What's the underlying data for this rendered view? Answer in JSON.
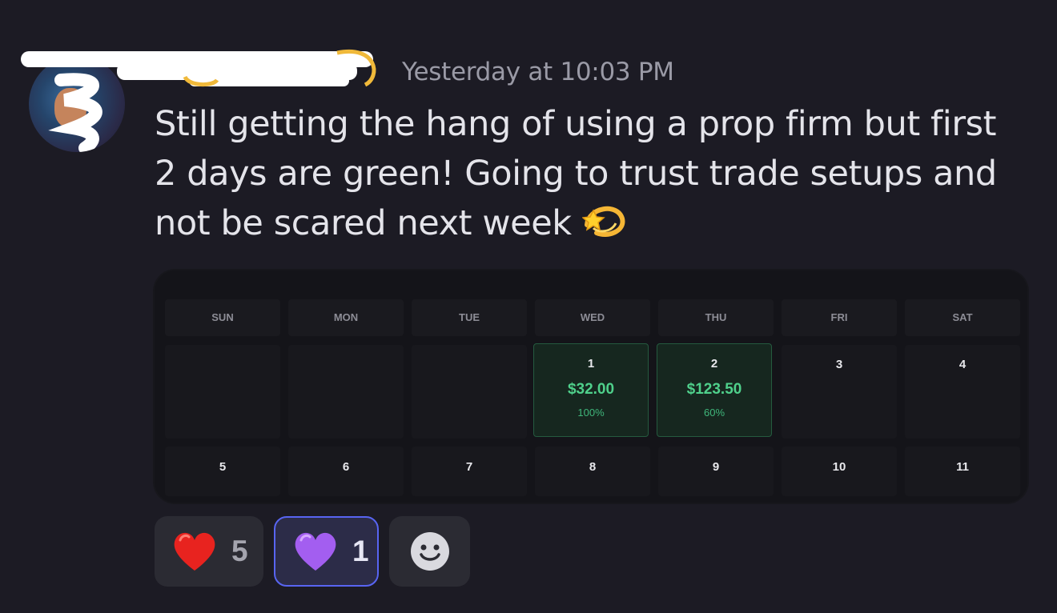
{
  "message": {
    "timestamp": "Yesterday at 10:03 PM",
    "text": "Still getting the hang of using a prop firm but first 2 days are green! Going to trust trade setups and not be scared next week",
    "trailing_emoji": "dizzy-emoji"
  },
  "calendar": {
    "weekdays": [
      "SUN",
      "MON",
      "TUE",
      "WED",
      "THU",
      "FRI",
      "SAT"
    ],
    "week1": [
      {
        "day": "",
        "pnl": "",
        "pct": ""
      },
      {
        "day": "",
        "pnl": "",
        "pct": ""
      },
      {
        "day": "",
        "pnl": "",
        "pct": ""
      },
      {
        "day": "1",
        "pnl": "$32.00",
        "pct": "100%"
      },
      {
        "day": "2",
        "pnl": "$123.50",
        "pct": "60%"
      },
      {
        "day": "3",
        "pnl": "",
        "pct": ""
      },
      {
        "day": "4",
        "pnl": "",
        "pct": ""
      }
    ],
    "week2": [
      "5",
      "6",
      "7",
      "8",
      "9",
      "10",
      "11"
    ]
  },
  "reactions": [
    {
      "emoji": "red-heart-emoji",
      "count": "5",
      "me": false
    },
    {
      "emoji": "purple-heart-emoji",
      "count": "1",
      "me": true
    }
  ],
  "colors": {
    "background": "#1c1b24",
    "profit_green": "#4fd08b",
    "reaction_selected_border": "#5865f2"
  }
}
